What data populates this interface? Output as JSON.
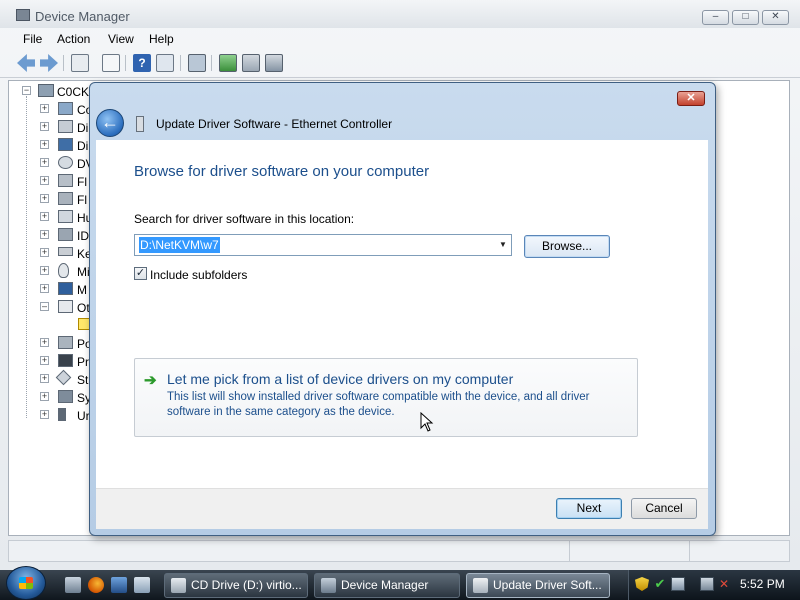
{
  "device_manager": {
    "title": "Device Manager",
    "window_controls": {
      "minimize": "–",
      "maximize": "□",
      "close": "✕"
    },
    "menu": [
      "File",
      "Action",
      "View",
      "Help"
    ],
    "toolbar_icons": [
      "back-icon",
      "forward-icon",
      "up-icon",
      "properties-icon",
      "help-icon",
      "console-tree-icon",
      "scan-hardware-icon",
      "update-driver-icon",
      "disable-icon",
      "uninstall-icon"
    ],
    "tree": {
      "root_label": "C0CK",
      "nodes": [
        {
          "label": "Co",
          "expander": "+"
        },
        {
          "label": "Di",
          "expander": "+"
        },
        {
          "label": "Di",
          "expander": "+"
        },
        {
          "label": "DV",
          "expander": "+"
        },
        {
          "label": "Fl",
          "expander": "+"
        },
        {
          "label": "Fl",
          "expander": "+"
        },
        {
          "label": "Hu",
          "expander": "+"
        },
        {
          "label": "ID",
          "expander": "+"
        },
        {
          "label": "Ke",
          "expander": "+"
        },
        {
          "label": "Mi",
          "expander": "+"
        },
        {
          "label": "M",
          "expander": "+"
        },
        {
          "label": "Ot",
          "expander": "–"
        },
        {
          "label": "Po",
          "expander": "+"
        },
        {
          "label": "Pr",
          "expander": "+"
        },
        {
          "label": "St",
          "expander": "+"
        },
        {
          "label": "Sy",
          "expander": "+"
        },
        {
          "label": "Ur",
          "expander": "+"
        }
      ]
    }
  },
  "dialog": {
    "title": "Update Driver Software - Ethernet Controller",
    "close_glyph": "✕",
    "back_glyph": "←",
    "heading": "Browse for driver software on your computer",
    "search_label": "Search for driver software in this location:",
    "path_value": "D:\\NetKVM\\w7",
    "dropdown_glyph": "▼",
    "browse_label": "Browse...",
    "include_subfolders": {
      "label": "Include subfolders",
      "checked": true,
      "glyph": "✓"
    },
    "pick": {
      "arrow_glyph": "➔",
      "title": "Let me pick from a list of device drivers on my computer",
      "description": "This list will show installed driver software compatible with the device, and all driver software in the same category as the device."
    },
    "next_label": "Next",
    "cancel_label": "Cancel"
  },
  "taskbar": {
    "tasks": [
      {
        "label": "CD Drive (D:) virtio...",
        "icon": "cd-drive-icon",
        "active": false
      },
      {
        "label": "Device Manager",
        "icon": "device-manager-icon",
        "active": false
      },
      {
        "label": "Update Driver Soft...",
        "icon": "update-driver-icon",
        "active": true
      }
    ],
    "quick_launch": [
      "firefox-icon",
      "show-desktop-icon",
      "switch-windows-icon"
    ],
    "tray_icons": [
      "security-shield-icon",
      "network-check-icon",
      "network-icon",
      "volume-muted-icon"
    ],
    "clock": "5:52 PM"
  },
  "colors": {
    "heading_blue": "#1c4f8c",
    "selection_blue": "#3399ff",
    "dialog_frame": "#b5cce5",
    "close_red": "#c2412d"
  }
}
